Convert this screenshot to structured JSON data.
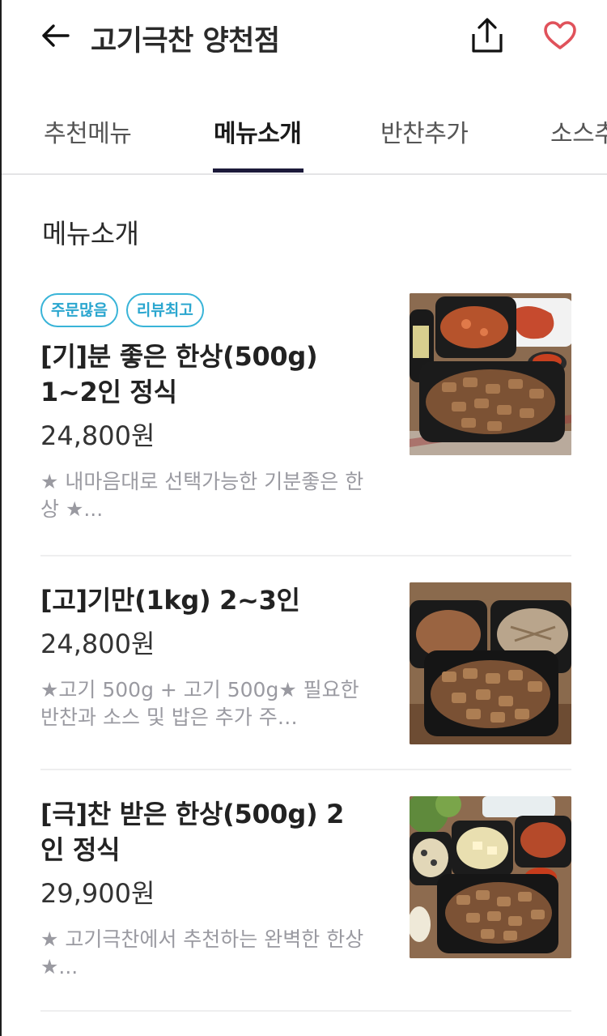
{
  "header": {
    "title": "고기극찬 양천점",
    "back_icon": "arrow-left-icon",
    "share_icon": "share-icon",
    "favorite_icon": "heart-icon",
    "favorite_color": "#e0525b"
  },
  "tabs": [
    {
      "label": "추천메뉴"
    },
    {
      "label": "메뉴소개",
      "active": true
    },
    {
      "label": "반찬추가"
    },
    {
      "label": "소스추"
    }
  ],
  "section": {
    "title": "메뉴소개"
  },
  "menu": [
    {
      "badges": [
        "주문많음",
        "리뷰최고"
      ],
      "name": "[기]분 좋은 한상(500g) 1~2인 정식",
      "price": "24,800원",
      "desc": "★ 내마음대로 선택가능한 기분좋은 한상 ★...",
      "image": "food-photo-grilled-pork-set"
    },
    {
      "badges": [],
      "name": "[고]기만(1kg)  2~3인",
      "price": "24,800원",
      "desc": "★고기 500g + 고기 500g★ 필요한 반찬과 소스 및 밥은 추가 주…",
      "image": "food-photo-grilled-pork-trays"
    },
    {
      "badges": [],
      "name": "[극]찬 받은 한상(500g)  2인 정식",
      "price": "29,900원",
      "desc": "★ 고기극찬에서 추천하는 완벽한 한상 ★...",
      "image": "food-photo-pork-soup-set"
    }
  ],
  "colors": {
    "accent": "#1c1a3a",
    "badge": "#39b4d8",
    "muted": "#9a9aa1"
  }
}
